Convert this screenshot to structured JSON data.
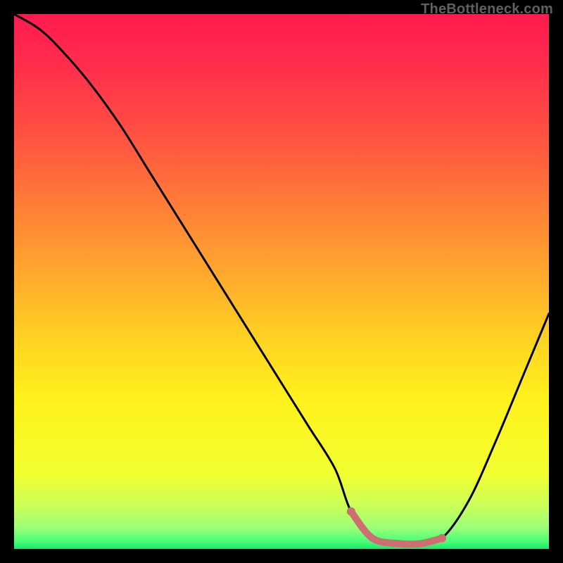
{
  "watermark": "TheBottleneck.com",
  "chart_data": {
    "type": "line",
    "title": "",
    "xlabel": "",
    "ylabel": "",
    "xlim": [
      0,
      100
    ],
    "ylim": [
      0,
      100
    ],
    "grid": false,
    "legend": "none",
    "annotations": [],
    "series": [
      {
        "name": "bottleneck_curve",
        "color": "#000000",
        "x": [
          0,
          5,
          10,
          15,
          20,
          25,
          30,
          35,
          40,
          45,
          50,
          55,
          60,
          63,
          67,
          72,
          76,
          80,
          85,
          90,
          95,
          100
        ],
        "y": [
          100,
          97,
          92,
          86,
          79,
          71,
          63,
          55,
          47,
          39,
          31,
          23,
          15,
          7,
          2,
          1,
          1,
          2,
          9,
          20,
          32,
          44
        ]
      },
      {
        "name": "optimal_band",
        "color": "#cc6e72",
        "x": [
          63,
          67,
          72,
          76,
          80
        ],
        "y": [
          7,
          2,
          1,
          1,
          2
        ]
      }
    ],
    "background_gradient": {
      "stops": [
        {
          "pos": 0.0,
          "color": "#ff1a4f"
        },
        {
          "pos": 0.1,
          "color": "#ff2f4b"
        },
        {
          "pos": 0.2,
          "color": "#ff4a44"
        },
        {
          "pos": 0.3,
          "color": "#ff6a3c"
        },
        {
          "pos": 0.4,
          "color": "#ff8c34"
        },
        {
          "pos": 0.5,
          "color": "#ffad2c"
        },
        {
          "pos": 0.6,
          "color": "#ffd024"
        },
        {
          "pos": 0.72,
          "color": "#fff21c"
        },
        {
          "pos": 0.86,
          "color": "#f2ff30"
        },
        {
          "pos": 0.92,
          "color": "#c9ff5a"
        },
        {
          "pos": 0.96,
          "color": "#9cff78"
        },
        {
          "pos": 0.985,
          "color": "#4dff78"
        },
        {
          "pos": 1.0,
          "color": "#17e86c"
        }
      ]
    }
  }
}
